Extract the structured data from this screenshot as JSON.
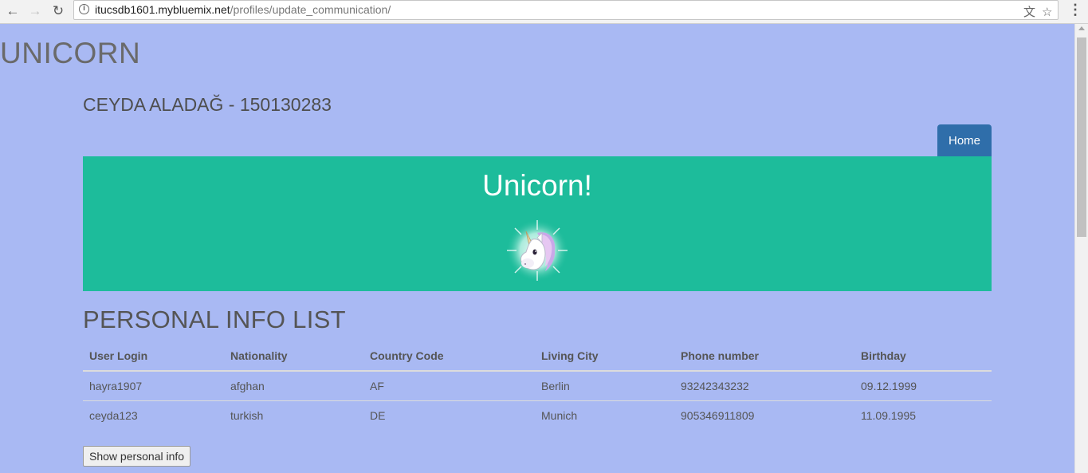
{
  "browser": {
    "url_host": "itucsdb1601.mybluemix.net",
    "url_path": "/profiles/update_communication/",
    "back_icon": "arrow-left-icon",
    "forward_icon": "arrow-right-icon",
    "reload_icon": "reload-icon",
    "translate_icon": "translate-icon",
    "bookmark_icon": "star-icon",
    "menu_icon": "kebab-menu-icon"
  },
  "header": {
    "logo": "UNICORN",
    "student": "CEYDA ALADAĞ - 150130283"
  },
  "nav": {
    "home_label": "Home",
    "home_color": "#2f6eaa"
  },
  "banner": {
    "title": "Unicorn!",
    "image": "unicorn-emoji",
    "color": "#1dbc9b"
  },
  "section": {
    "title": "PERSONAL INFO LIST"
  },
  "table": {
    "headers": [
      "User Login",
      "Nationality",
      "Country Code",
      "Living City",
      "Phone number",
      "Birthday"
    ],
    "rows": [
      [
        "hayra1907",
        "afghan",
        "AF",
        "Berlin",
        "93242343232",
        "09.12.1999"
      ],
      [
        "ceyda123",
        "turkish",
        "DE",
        "Munich",
        "905346911809",
        "11.09.1995"
      ]
    ]
  },
  "actions": {
    "show_label": "Show personal info"
  },
  "colors": {
    "background": "#a9b9f3"
  }
}
